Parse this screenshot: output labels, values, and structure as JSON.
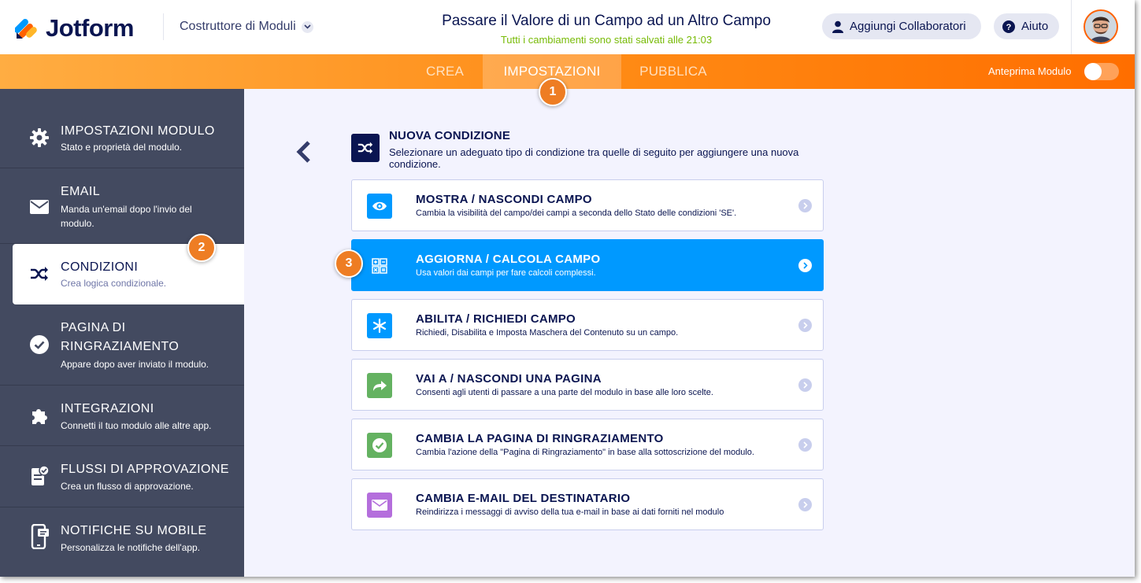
{
  "colors": {
    "brand": "#0a1551",
    "orange": "#ff6100",
    "selected": "#0099ff",
    "sidebar": "#434a60",
    "saved": "#78bb07"
  },
  "header": {
    "logo_text": "Jotform",
    "builder_label": "Costruttore di Moduli",
    "form_title": "Passare il Valore di un Campo ad un Altro Campo",
    "saved_status": "Tutti i cambiamenti sono stati salvati alle 21:03",
    "collaborators_label": "Aggiungi Collaboratori",
    "help_label": "Aiuto"
  },
  "topbar": {
    "tabs": [
      {
        "label": "CREA"
      },
      {
        "label": "IMPOSTAZIONI",
        "active": true
      },
      {
        "label": "PUBBLICA"
      }
    ],
    "preview_label": "Anteprima Modulo"
  },
  "badges": [
    "1",
    "2",
    "3"
  ],
  "sidebar": {
    "items": [
      {
        "title": "IMPOSTAZIONI MODULO",
        "desc": "Stato e proprietà del modulo.",
        "icon": "gear-icon"
      },
      {
        "title": "EMAIL",
        "desc": "Manda un'email dopo l'invio del modulo.",
        "icon": "envelope-icon"
      },
      {
        "title": "CONDIZIONI",
        "desc": "Crea logica condizionale.",
        "icon": "shuffle-icon",
        "active": true
      },
      {
        "title": "PAGINA DI RINGRAZIAMENTO",
        "desc": "Appare dopo aver inviato il modulo.",
        "icon": "check-circle-icon"
      },
      {
        "title": "INTEGRAZIONI",
        "desc": "Connetti il tuo modulo alle altre app.",
        "icon": "puzzle-icon"
      },
      {
        "title": "FLUSSI DI APPROVAZIONE",
        "desc": "Crea un flusso di approvazione.",
        "icon": "approval-doc-icon"
      },
      {
        "title": "NOTIFICHE SU MOBILE",
        "desc": "Personalizza le notifiche dell'app.",
        "icon": "mobile-icon"
      }
    ]
  },
  "main": {
    "heading": "NUOVA CONDIZIONE",
    "description": "Selezionare un adeguato tipo di condizione tra quelle di seguito per aggiungere una nuova condizione.",
    "conditions": [
      {
        "title": "MOSTRA / NASCONDI CAMPO",
        "desc": "Cambia la visibilità del campo/dei campi a seconda dello Stato delle condizioni 'SE'.",
        "icon": "eye-icon",
        "color": "#0099ff"
      },
      {
        "title": "AGGIORNA / CALCOLA CAMPO",
        "desc": "Usa valori dai campi per fare calcoli complessi.",
        "icon": "calculator-icon",
        "color": "#0099ff",
        "selected": true
      },
      {
        "title": "ABILITA / RICHIEDI CAMPO",
        "desc": "Richiedi, Disabilita e Imposta Maschera del Contenuto su un campo.",
        "icon": "asterisk-icon",
        "color": "#0099ff"
      },
      {
        "title": "VAI A / NASCONDI UNA PAGINA",
        "desc": "Consenti agli utenti di passare a una parte del modulo in base alle loro scelte.",
        "icon": "share-arrow-icon",
        "color": "#64b261"
      },
      {
        "title": "CAMBIA LA PAGINA DI RINGRAZIAMENTO",
        "desc": "Cambia l'azione della \"Pagina di Ringraziamento\" in base alla sottoscrizione del modulo.",
        "icon": "check-circle-icon",
        "color": "#64b261"
      },
      {
        "title": "CAMBIA E-MAIL DEL DESTINATARIO",
        "desc": "Reindirizza i messaggi di avviso della tua e-mail in base ai dati forniti nel modulo",
        "icon": "envelope-icon",
        "color": "#b46edc"
      }
    ]
  }
}
